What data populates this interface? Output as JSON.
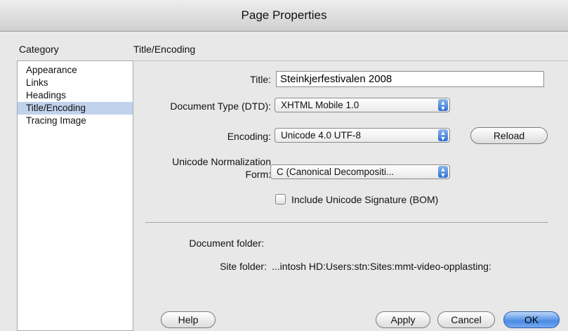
{
  "window": {
    "title": "Page Properties"
  },
  "category": {
    "header": "Category",
    "items": [
      "Appearance",
      "Links",
      "Headings",
      "Title/Encoding",
      "Tracing Image"
    ],
    "selected_index": 3
  },
  "section": {
    "header": "Title/Encoding"
  },
  "form": {
    "title_label": "Title:",
    "title_value": "Steinkjerfestivalen 2008",
    "doctype_label": "Document Type (DTD):",
    "doctype_value": "XHTML Mobile 1.0",
    "encoding_label": "Encoding:",
    "encoding_value": "Unicode 4.0 UTF-8",
    "reload_label": "Reload",
    "normalization_label_line1": "Unicode Normalization",
    "normalization_label_line2": "Form:",
    "normalization_value": "C (Canonical Decompositi...",
    "bom_label": "Include Unicode Signature (BOM)",
    "bom_checked": false,
    "document_folder_label": "Document folder:",
    "document_folder_value": "",
    "site_folder_label": "Site folder:",
    "site_folder_value": "...intosh HD:Users:stn:Sites:mmt-video-opplasting:"
  },
  "buttons": {
    "help": "Help",
    "apply": "Apply",
    "cancel": "Cancel",
    "ok": "OK"
  },
  "colors": {
    "selection": "#c0d2ec",
    "default_button": "#4a8be2",
    "popup_arrows": "#2e6fd3"
  },
  "icons": {
    "popup_arrows": "up-down-arrows-icon"
  }
}
